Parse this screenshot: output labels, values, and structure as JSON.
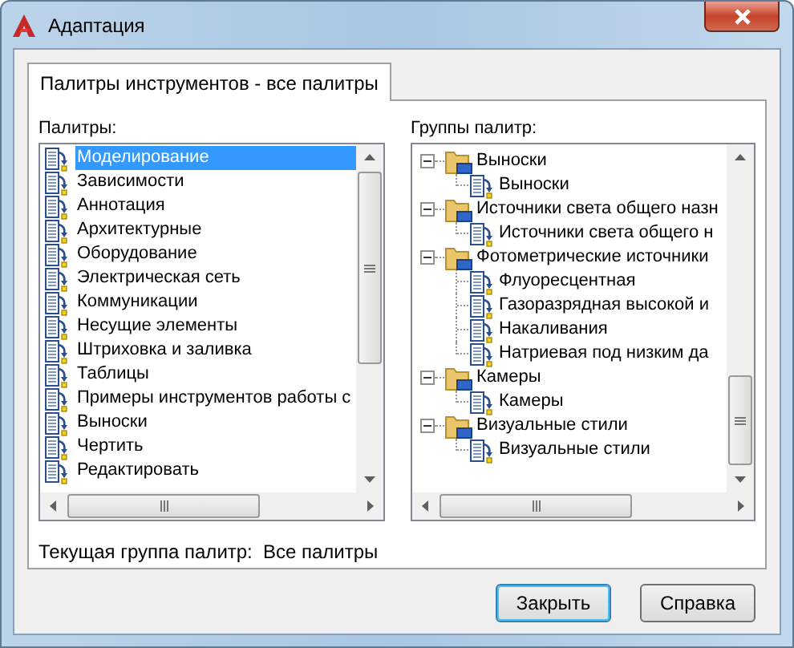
{
  "window": {
    "title": "Адаптация"
  },
  "tabs": [
    {
      "label": "Палитры инструментов - все палитры",
      "selected": true
    }
  ],
  "palettes": {
    "label": "Палитры:",
    "items": [
      {
        "label": "Моделирование",
        "selected": true
      },
      {
        "label": "Зависимости",
        "selected": false
      },
      {
        "label": "Аннотация",
        "selected": false
      },
      {
        "label": "Архитектурные",
        "selected": false
      },
      {
        "label": "Оборудование",
        "selected": false
      },
      {
        "label": "Электрическая сеть",
        "selected": false
      },
      {
        "label": "Коммуникации",
        "selected": false
      },
      {
        "label": "Несущие элементы",
        "selected": false
      },
      {
        "label": "Штриховка и заливка",
        "selected": false
      },
      {
        "label": "Таблицы",
        "selected": false
      },
      {
        "label": "Примеры инструментов работы с",
        "selected": false
      },
      {
        "label": "Выноски",
        "selected": false
      },
      {
        "label": "Чертить",
        "selected": false
      },
      {
        "label": "Редактировать",
        "selected": false
      }
    ]
  },
  "palette_groups": {
    "label": "Группы палитр:",
    "tree": [
      {
        "label": "Выноски",
        "expanded": true,
        "children": [
          {
            "label": "Выноски"
          }
        ]
      },
      {
        "label": "Источники света общего назн",
        "expanded": true,
        "children": [
          {
            "label": "Источники света общего н"
          }
        ]
      },
      {
        "label": "Фотометрические источники",
        "expanded": true,
        "children": [
          {
            "label": "Флуоресцентная"
          },
          {
            "label": "Газоразрядная высокой и"
          },
          {
            "label": "Накаливания"
          },
          {
            "label": "Натриевая под низким да"
          }
        ]
      },
      {
        "label": "Камеры",
        "expanded": true,
        "children": [
          {
            "label": "Камеры"
          }
        ]
      },
      {
        "label": "Визуальные стили",
        "expanded": true,
        "children": [
          {
            "label": "Визуальные стили"
          }
        ]
      }
    ]
  },
  "current_group": {
    "label": "Текущая группа палитр:",
    "value": "Все палитры"
  },
  "buttons": [
    {
      "label": "Закрыть",
      "default": true
    },
    {
      "label": "Справка",
      "default": false
    }
  ]
}
